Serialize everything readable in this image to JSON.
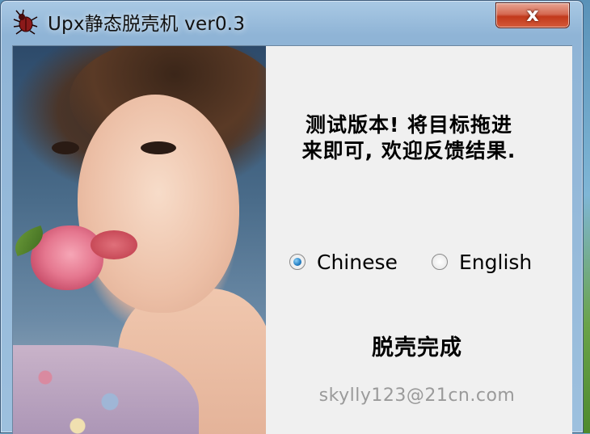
{
  "window": {
    "title": "Upx静态脱壳机 ver0.3",
    "close_label": "x",
    "icon": "bug-icon"
  },
  "content": {
    "notice_line1": "测试版本! 将目标拖进",
    "notice_line2": "来即可, 欢迎反馈结果.",
    "language": {
      "options": [
        {
          "label": "Chinese",
          "checked": true
        },
        {
          "label": "English",
          "checked": false
        }
      ]
    },
    "status": "脱壳完成",
    "email": "skylly123@21cn.com"
  },
  "colors": {
    "accent": "#2a85c9",
    "email_text": "#9a9a9a",
    "close_button": "#c2391b"
  }
}
